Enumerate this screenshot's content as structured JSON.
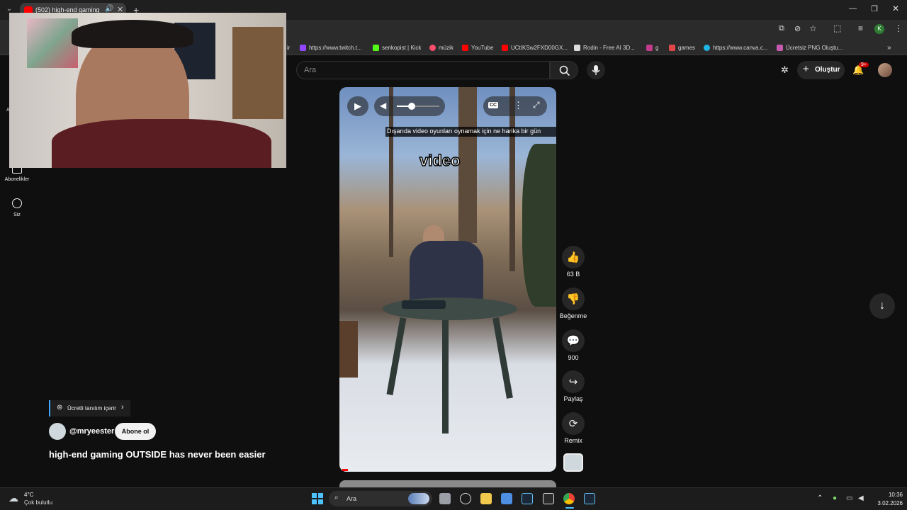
{
  "browser": {
    "tab_title": "(502) high-end gaming OU",
    "bookmarks": [
      {
        "label": "https://www.twitch.t...",
        "color": "#9146ff"
      },
      {
        "label": "senkopist | Kick",
        "color": "#53fc18"
      },
      {
        "label": "müzik",
        "color": "#ff4d6d"
      },
      {
        "label": "YouTube",
        "color": "#ff0000"
      },
      {
        "label": "UCtIKSw2FXD00GX...",
        "color": "#ff0000"
      },
      {
        "label": "Rodin - Free AI 3D...",
        "color": "#dddddd"
      },
      {
        "label": "g",
        "color": "#c23b8c"
      },
      {
        "label": "games",
        "color": "#e04848"
      },
      {
        "label": "https://www.canva.c...",
        "color": "#1fb6e6"
      },
      {
        "label": "Ücretsiz PNG Oluştu...",
        "color": "#c55ab0"
      }
    ],
    "bookmark_prefix": "ir",
    "more_label": "»"
  },
  "youtube": {
    "search_placeholder": "Ara",
    "create_label": "Oluştur",
    "notification_count": "9+",
    "sidebar": [
      {
        "label": "Abonelikler",
        "icon": "subscriptions-icon"
      },
      {
        "label": "Siz",
        "icon": "profile-icon"
      }
    ],
    "sidebar_partial_letter": "A"
  },
  "video": {
    "caption": "Dışarıda video oyunları oynamak için ne harika bir gün",
    "overlay_word": "video",
    "cc_label": "CC"
  },
  "actions": {
    "likes": "63 B",
    "dislike_label": "Beğenme",
    "comments": "900",
    "share_label": "Paylaş",
    "remix_label": "Remix"
  },
  "channel": {
    "paid_promo": "Ücretli tanıtım içerir",
    "handle": "@mryeester",
    "subscribe_label": "Abone ol",
    "title": "high-end gaming OUTSIDE has never been easier"
  },
  "taskbar": {
    "weather_temp": "4°C",
    "weather_desc": "Çok bulutlu",
    "search_label": "Ara",
    "time": "10:36",
    "date": "3.02.2026"
  }
}
